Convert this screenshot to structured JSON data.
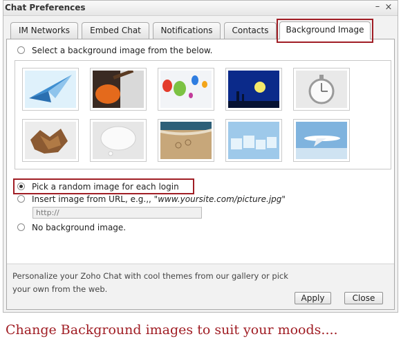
{
  "window": {
    "title": "Chat Preferences",
    "minimize_glyph": "–",
    "close_glyph": "×"
  },
  "tabs": [
    {
      "label": "IM Networks"
    },
    {
      "label": "Embed Chat"
    },
    {
      "label": "Notifications"
    },
    {
      "label": "Contacts"
    },
    {
      "label": "Background Image",
      "active": true
    }
  ],
  "options": {
    "gallery_label": "Select a background image from the below.",
    "random_label": "Pick a random image for each login",
    "url_label": "Insert image from URL, e.g.,, ",
    "url_hint": "\"www.yoursite.com/picture.jpg\"",
    "url_value": "http://",
    "none_label": "No background image.",
    "selected": "random"
  },
  "gallery": [
    {
      "name": "paper-plane-thumbnail",
      "colors": [
        "#dff1fb",
        "#3f8fd1"
      ]
    },
    {
      "name": "guitar-thumbnail",
      "colors": [
        "#3a2a22",
        "#e46a1c"
      ]
    },
    {
      "name": "hot-air-balloons-thumbnail",
      "colors": [
        "#f2f4f7",
        "#e33b2b"
      ]
    },
    {
      "name": "night-silhouette-thumbnail",
      "colors": [
        "#0b2a8a",
        "#f5e96a"
      ]
    },
    {
      "name": "stopwatch-thumbnail",
      "colors": [
        "#e9e9e9",
        "#9a9a9a"
      ]
    },
    {
      "name": "torn-paper-thumbnail",
      "colors": [
        "#ececec",
        "#8b5a32"
      ]
    },
    {
      "name": "speech-bubble-thumbnail",
      "colors": [
        "#e6e6e6",
        "#fafafa"
      ]
    },
    {
      "name": "sand-zoho-thumbnail",
      "colors": [
        "#c7a77a",
        "#2d5f78"
      ]
    },
    {
      "name": "ice-cubes-thumbnail",
      "colors": [
        "#9ec9ea",
        "#e6f3fb"
      ]
    },
    {
      "name": "airplane-thumbnail",
      "colors": [
        "#7fb3de",
        "#ffffff"
      ]
    }
  ],
  "footer": {
    "text": "Personalize your Zoho Chat with cool themes from our gallery or pick your own from the web.",
    "apply_label": "Apply",
    "close_label": "Close"
  },
  "caption": "Change Background images to suit your moods....",
  "colors": {
    "highlight": "#a01d24",
    "caption": "#a01d24"
  }
}
